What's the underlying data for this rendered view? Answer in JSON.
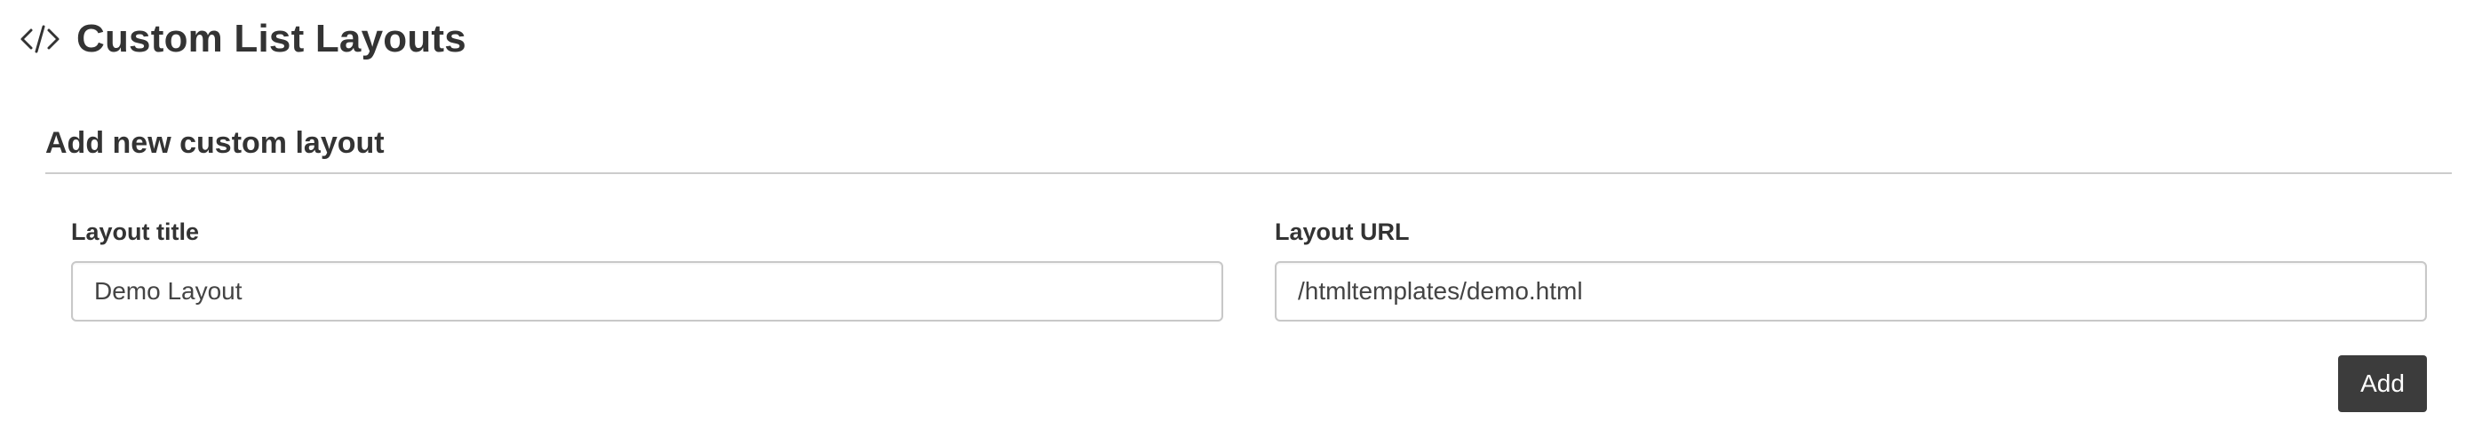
{
  "header": {
    "title": "Custom List Layouts",
    "icon": "code-icon"
  },
  "section": {
    "title": "Add new custom layout"
  },
  "form": {
    "layout_title": {
      "label": "Layout title",
      "value": "Demo Layout"
    },
    "layout_url": {
      "label": "Layout URL",
      "value": "/htmltemplates/demo.html"
    },
    "add_label": "Add"
  },
  "colors": {
    "text": "#333333",
    "button_bg": "#3c3c3c",
    "button_text": "#ffffff",
    "divider": "#cccccc",
    "input_border": "#c8c8c8"
  }
}
